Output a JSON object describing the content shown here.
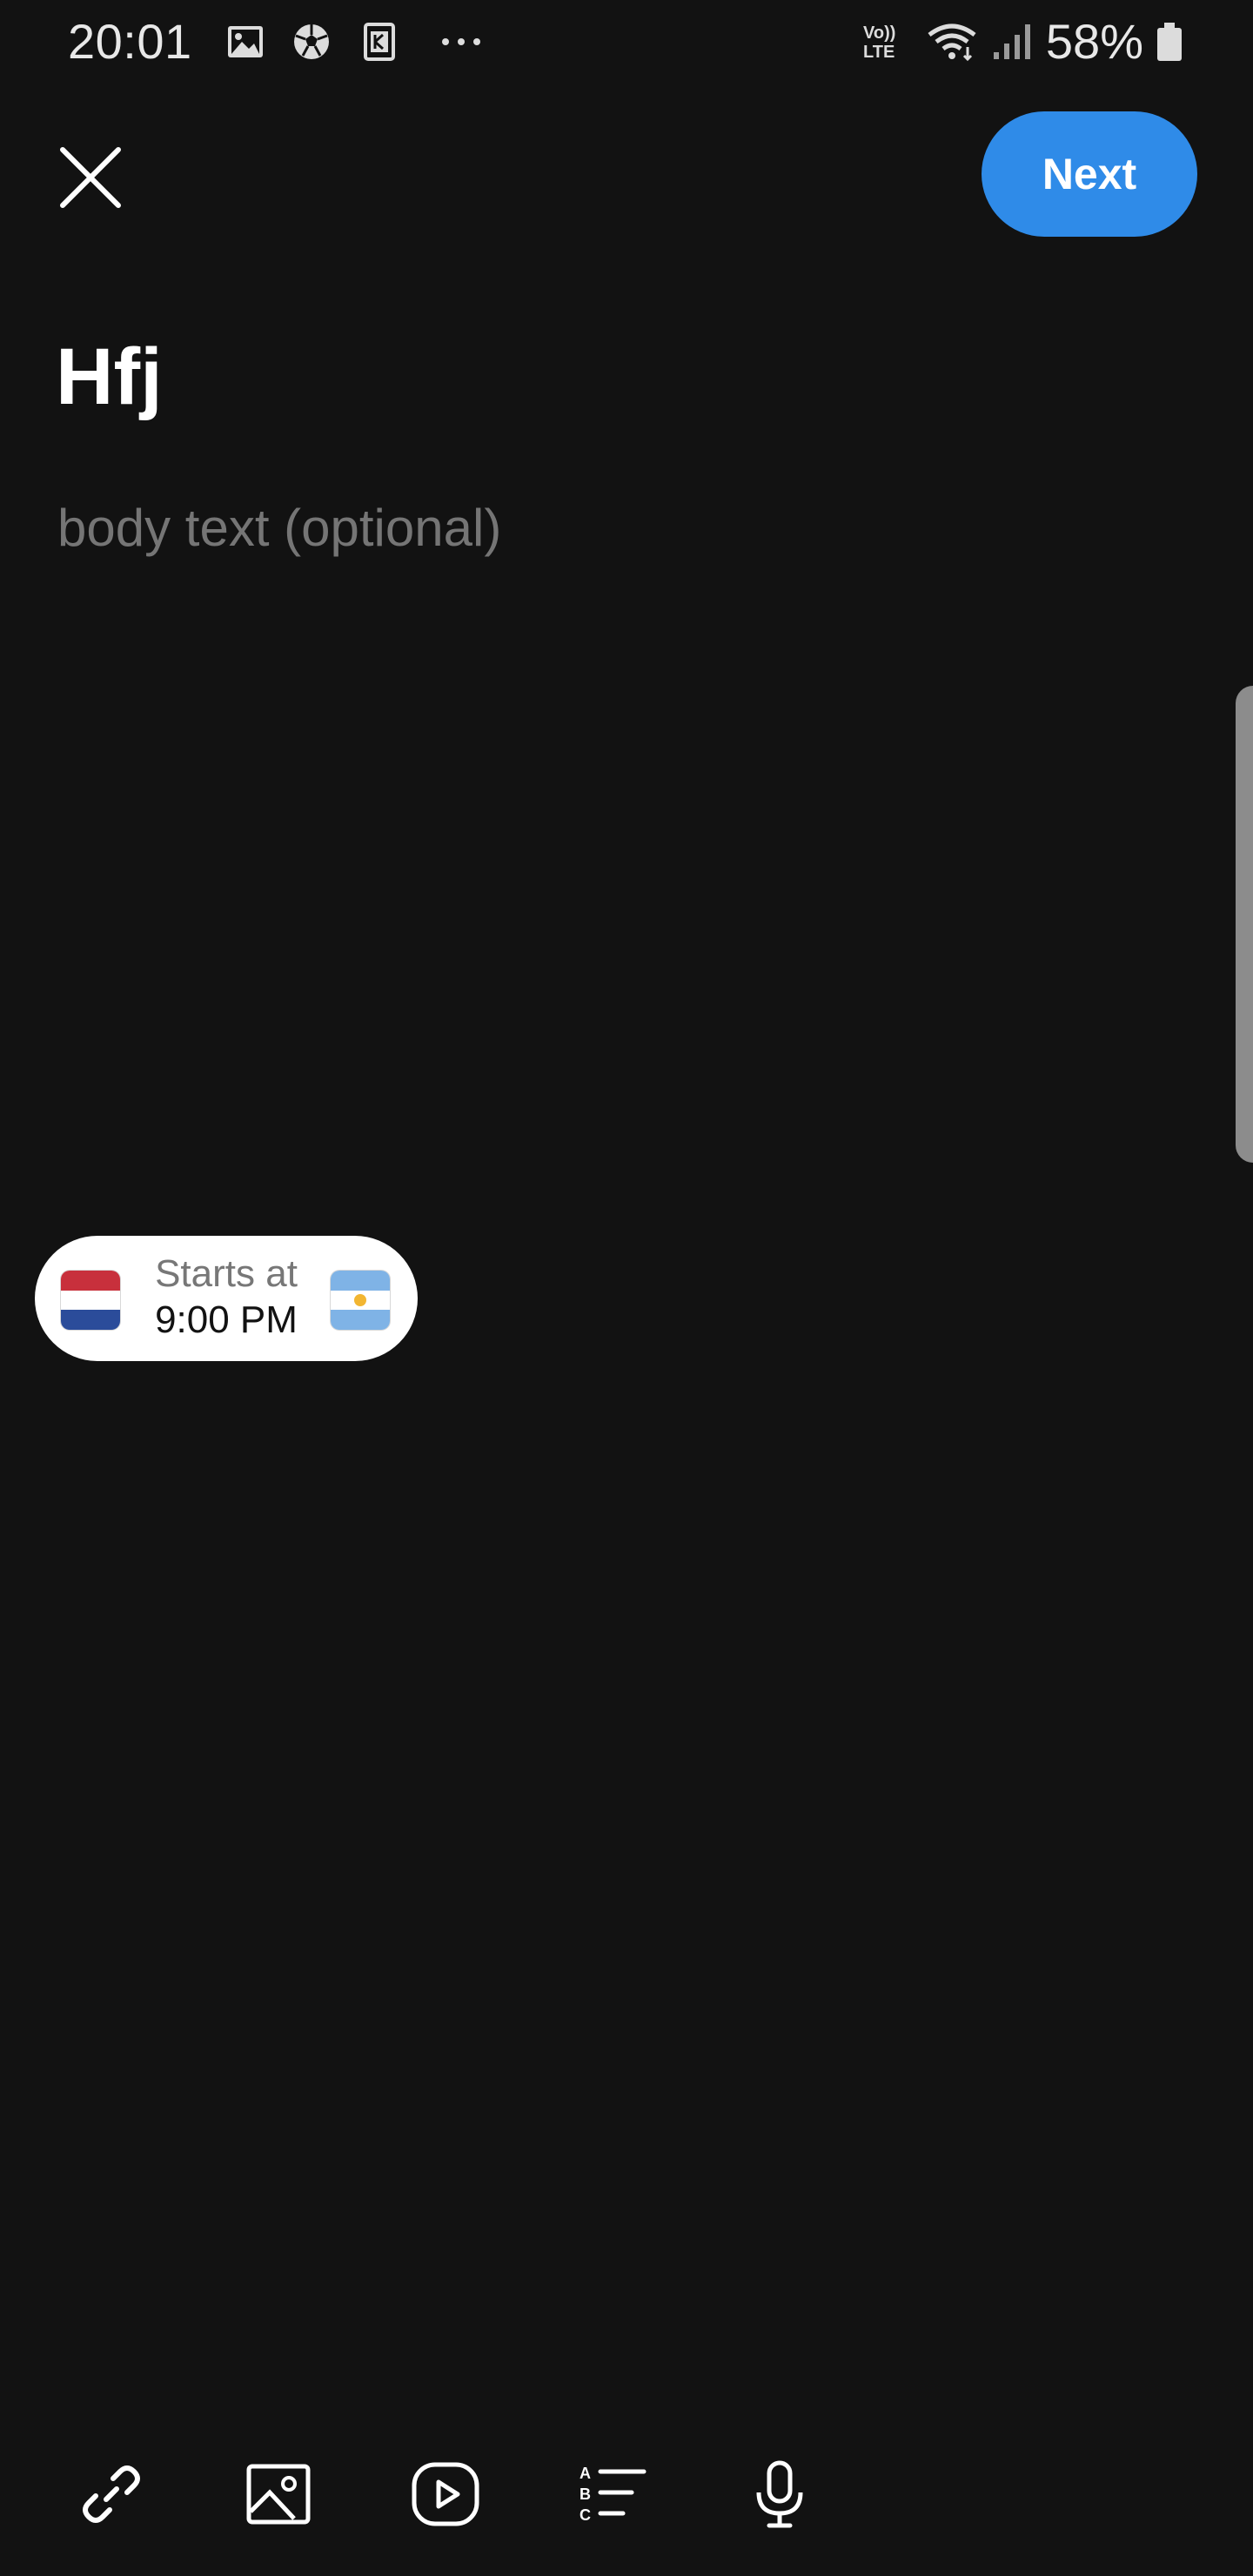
{
  "status_bar": {
    "time": "20:01",
    "battery": "58%",
    "icons": [
      "image-notification-icon",
      "soccer-ball-icon",
      "k-app-icon",
      "more-dots-icon",
      "volte-icon",
      "wifi-icon",
      "signal-icon",
      "battery-icon"
    ]
  },
  "header": {
    "close_icon": "close-icon",
    "next_label": "Next",
    "accent_color": "#2f8be8"
  },
  "post": {
    "title": "Hfj",
    "body_placeholder": "body text (optional)"
  },
  "match": {
    "home_flag": "netherlands-flag-icon",
    "away_flag": "argentina-flag-icon",
    "label": "Starts at",
    "time": "9:00 PM"
  },
  "toolbar": {
    "items": [
      "link-icon",
      "image-icon",
      "video-icon",
      "poll-icon",
      "microphone-icon"
    ]
  }
}
